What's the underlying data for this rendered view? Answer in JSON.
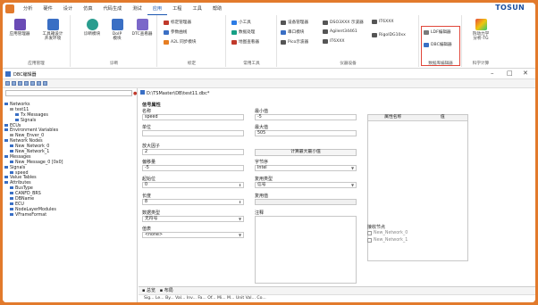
{
  "ribbon": {
    "tabs": [
      "分析",
      "硬件",
      "设计",
      "仿真",
      "代码生成",
      "测试",
      "应用",
      "工程",
      "工具",
      "帮助"
    ],
    "active_tab": "应用",
    "logo": "TOSUN",
    "groups": [
      {
        "label": "应用管理",
        "items": [
          "应用管理器",
          "工具箱设计\n开发环境"
        ]
      },
      {
        "label": "诊断",
        "items": [
          "诊断模块",
          "DoIP\n模块",
          "DTC查看器"
        ]
      },
      {
        "label": "标定",
        "items": [
          "标定管理器",
          "参数曲线",
          "A2L 同步模块"
        ]
      },
      {
        "label": "常用工具",
        "items": [
          "小工具",
          "数据处理",
          "地图查看器"
        ]
      },
      {
        "label": "仪器设备",
        "items": [
          "设备管理器",
          "串口模块",
          "Pico示波器",
          "DSO3XXX 示波器",
          "Agilent34461",
          "IT6XXX",
          "IT6XXX",
          "RigolDG10xx"
        ]
      },
      {
        "label": "数据库编辑器",
        "items": [
          "LDF编辑器",
          "DBC编辑器"
        ]
      },
      {
        "label": "科学计算",
        "items": [
          "热动力学\n分析-TG"
        ]
      }
    ]
  },
  "window": {
    "title": "DBC编辑器",
    "min": "–",
    "max": "□",
    "close": "✕"
  },
  "tree": [
    {
      "text": "Networks",
      "level": 0,
      "icon": "#3a6fc4"
    },
    {
      "text": "test11",
      "level": 1,
      "icon": "#999"
    },
    {
      "text": "Tx Messages",
      "level": 2,
      "icon": "#3a6fc4"
    },
    {
      "text": "Signals",
      "level": 2,
      "icon": "#3a6fc4"
    },
    {
      "text": "ECUs",
      "level": 0,
      "icon": "#3a6fc4"
    },
    {
      "text": "Environment Variables",
      "level": 0,
      "icon": "#3a6fc4"
    },
    {
      "text": "New_Enver_0",
      "level": 1,
      "icon": "#999"
    },
    {
      "text": "Network Nodes",
      "level": 0,
      "icon": "#3a6fc4"
    },
    {
      "text": "New_Network_0",
      "level": 1,
      "icon": "#3a6fc4"
    },
    {
      "text": "New_Network_1",
      "level": 1,
      "icon": "#3a6fc4"
    },
    {
      "text": "Messages",
      "level": 0,
      "icon": "#3a6fc4"
    },
    {
      "text": "New_Message_0 [0x0]",
      "level": 1,
      "icon": "#3a6fc4"
    },
    {
      "text": "Signals",
      "level": 0,
      "icon": "#3a6fc4"
    },
    {
      "text": "speed",
      "level": 1,
      "icon": "#3a6fc4"
    },
    {
      "text": "Value Tables",
      "level": 0,
      "icon": "#3a6fc4"
    },
    {
      "text": "Attributes",
      "level": 0,
      "icon": "#3a6fc4"
    },
    {
      "text": "BusType",
      "level": 1,
      "icon": "#3a6fc4"
    },
    {
      "text": "CANFD_BRS",
      "level": 1,
      "icon": "#3a6fc4"
    },
    {
      "text": "DBName",
      "level": 1,
      "icon": "#3a6fc4"
    },
    {
      "text": "ECU",
      "level": 1,
      "icon": "#3a6fc4"
    },
    {
      "text": "NodeLayerModules",
      "level": 1,
      "icon": "#3a6fc4"
    },
    {
      "text": "VFrameFormat",
      "level": 1,
      "icon": "#3a6fc4"
    }
  ],
  "editor": {
    "path": "D:\\TSMaster\\DB\\test11.dbc*",
    "section": "信号属性",
    "name_label": "名称",
    "name_value": "speed",
    "min_label": "最小值",
    "min_value": "-5",
    "unit_label": "单位",
    "unit_value": "",
    "max_label": "最大值",
    "max_value": "505",
    "factor_label": "放大因子",
    "factor_value": "2",
    "calc_btn": "计算最大最小值",
    "offset_label": "偏移量",
    "offset_value": "-5",
    "byteorder_label": "字节序",
    "byteorder_value": "Intel",
    "startbit_label": "起始位",
    "startbit_value": "0",
    "muxtype_label": "复用类型",
    "muxtype_value": "信号",
    "length_label": "长度",
    "length_value": "8",
    "muxval_label": "复用值",
    "muxval_value": "",
    "datatype_label": "数据类型",
    "datatype_value": "无符号",
    "comment_label": "注释",
    "valtable_label": "值表",
    "valtable_value": "<none>",
    "prop_header_name": "属性名称",
    "prop_header_value": "值",
    "receivers_label": "接收节点",
    "receivers": [
      "New_Network_0",
      "New_Network_1"
    ],
    "bottom_tabs": [
      "总览",
      "布局"
    ],
    "bottom_cols": "Sig... Le... By... Val... Inv... Fa... Of... Mi... M... Unit Val... Co..."
  },
  "colors": {
    "accent": "#1a56b0",
    "frame": "#e27a2c",
    "highlight": "#e0463a"
  }
}
